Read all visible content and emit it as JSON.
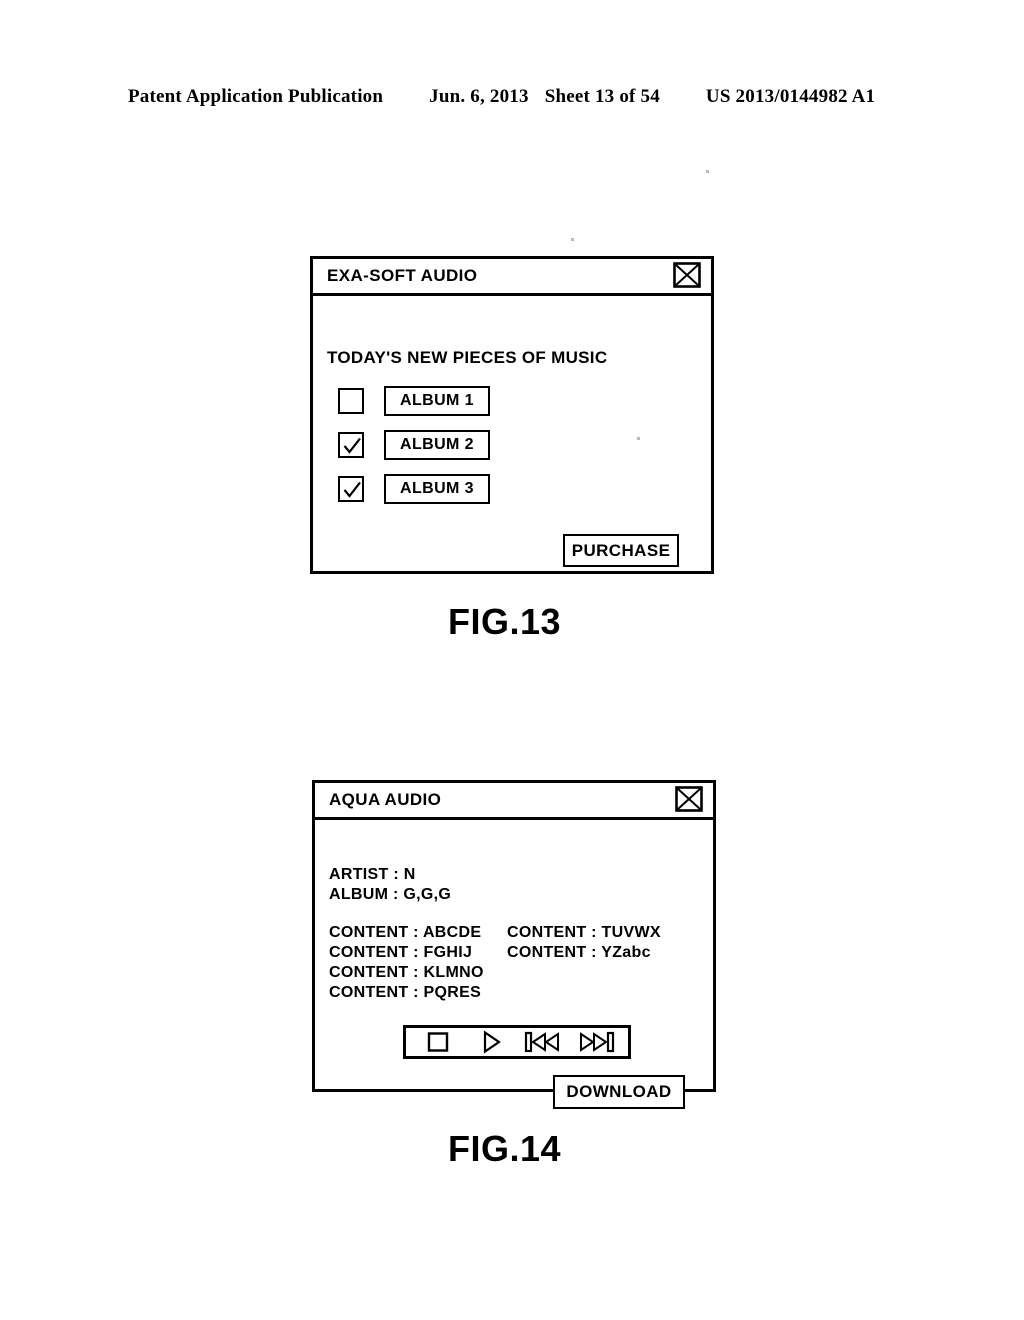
{
  "page_header": {
    "publication": "Patent Application Publication",
    "date": "Jun. 6, 2013",
    "sheet": "Sheet 13 of 54",
    "number": "US 2013/0144982 A1"
  },
  "figures": [
    {
      "caption": "FIG.13",
      "window": {
        "title": "EXA-SOFT AUDIO",
        "close_icon": "close-box-x-icon",
        "heading": "TODAY'S NEW PIECES OF MUSIC",
        "albums": [
          {
            "label": "ALBUM 1",
            "checked": false
          },
          {
            "label": "ALBUM 2",
            "checked": true
          },
          {
            "label": "ALBUM 3",
            "checked": true
          }
        ],
        "action_button": "PURCHASE"
      }
    },
    {
      "caption": "FIG.14",
      "window": {
        "title": "AQUA AUDIO",
        "close_icon": "close-box-x-icon",
        "meta": {
          "artist": "ARTIST : N",
          "album": "ALBUM : G,G,G"
        },
        "content_left": [
          "CONTENT : ABCDE",
          "CONTENT : FGHIJ",
          "CONTENT : KLMNO",
          "CONTENT : PQRES"
        ],
        "content_right": [
          "CONTENT : TUVWX",
          "CONTENT : YZabc"
        ],
        "transport": [
          {
            "name": "stop-icon",
            "glyph": "square"
          },
          {
            "name": "play-icon",
            "glyph": "triangle-right"
          },
          {
            "name": "previous-icon",
            "glyph": "bar-double-left"
          },
          {
            "name": "next-icon",
            "glyph": "double-right-bar"
          }
        ],
        "action_button": "DOWNLOAD"
      }
    }
  ],
  "colors": {
    "ink": "#000000",
    "paper": "#ffffff"
  }
}
